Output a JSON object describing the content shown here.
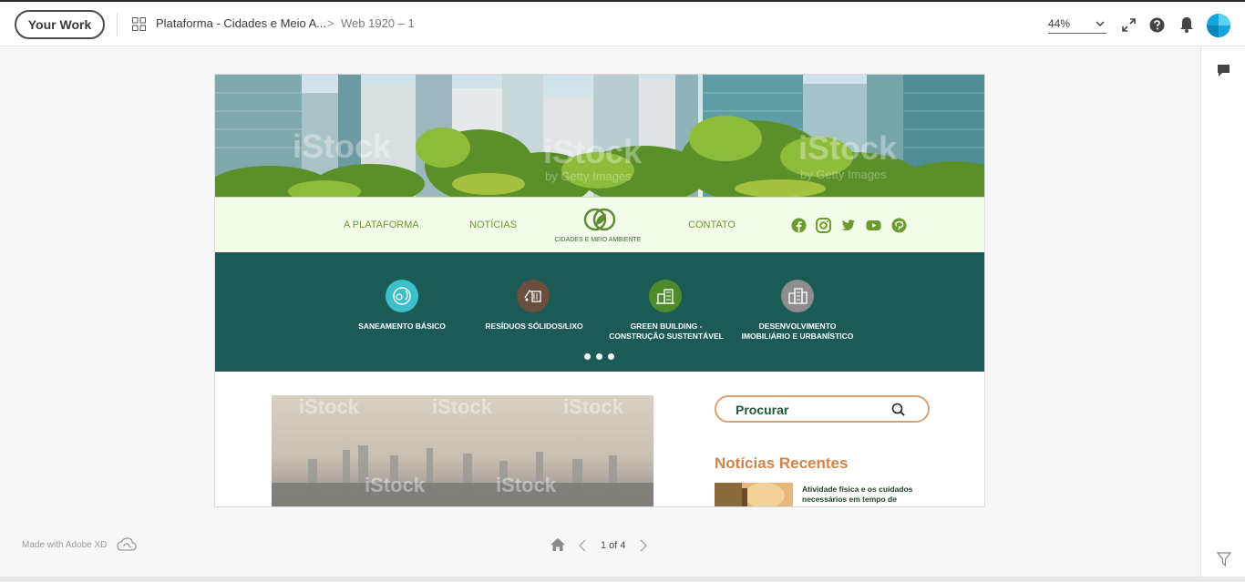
{
  "topbar": {
    "your_work_label": "Your Work",
    "project_name": "Plataforma - Cidades e Meio A...",
    "separator": ">",
    "artboard_name": "Web 1920 – 1",
    "zoom_value": "44%"
  },
  "site": {
    "nav": {
      "item1": "A PLATAFORMA",
      "item2": "NOTÍCIAS",
      "logo_text": "CIDADES E MEIO AMBIENTE",
      "item3": "CONTATO"
    },
    "categories": [
      {
        "label_line1": "SANEAMENTO BÁSICO",
        "label_line2": "",
        "color": "#3bbfc9"
      },
      {
        "label_line1": "RESÍDUOS SÓLIDOS/LIXO",
        "label_line2": "",
        "color": "#6a4f3e"
      },
      {
        "label_line1": "GREEN BUILDING -",
        "label_line2": "CONSTRUÇÃO SUSTENTÁVEL",
        "color": "#4f8a2c"
      },
      {
        "label_line1": "DESENVOLVIMENTO",
        "label_line2": "IMOBILIÁRIO E URBANÍSTICO",
        "color": "#8d8d8d"
      }
    ],
    "search_label": "Procurar",
    "recent_title": "Notícias Recentes",
    "recent_item_text": "Atividade física e os cuidados necessários em tempo de isolamento social",
    "watermark": "iStock",
    "watermark_sub": "by Getty Images"
  },
  "footer": {
    "made_with": "Made with Adobe XD",
    "page_indicator": "1 of 4"
  },
  "colors": {
    "teal_band": "#1b5a55",
    "nav_green": "#6b9a2f",
    "accent_orange": "#d0844a",
    "avatar_blue": "#12a6dc"
  }
}
